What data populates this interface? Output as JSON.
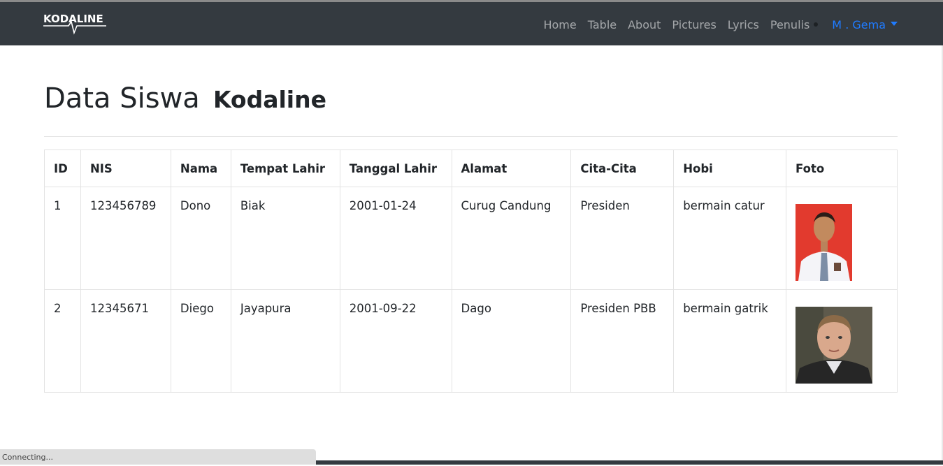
{
  "brand": {
    "logo_text": "KODALINE"
  },
  "nav": {
    "items": [
      "Home",
      "Table",
      "About",
      "Pictures",
      "Lyrics",
      "Penulis"
    ],
    "user_label": "M . Gema"
  },
  "page": {
    "title": "Data Siswa",
    "subtitle": "Kodaline"
  },
  "table": {
    "headers": [
      "ID",
      "NIS",
      "Nama",
      "Tempat Lahir",
      "Tanggal Lahir",
      "Alamat",
      "Cita-Cita",
      "Hobi",
      "Foto"
    ],
    "rows": [
      [
        "1",
        "123456789",
        "Dono",
        "Biak",
        "2001-01-24",
        "Curug Candung",
        "Presiden",
        "bermain catur"
      ],
      [
        "2",
        "12345671",
        "Diego",
        "Jayapura",
        "2001-09-22",
        "Dago",
        "Presiden PBB",
        "bermain gatrik"
      ]
    ]
  },
  "status": {
    "text": "Connecting..."
  },
  "colors": {
    "navbar": "#343a40",
    "link_active": "#1f7bff"
  }
}
